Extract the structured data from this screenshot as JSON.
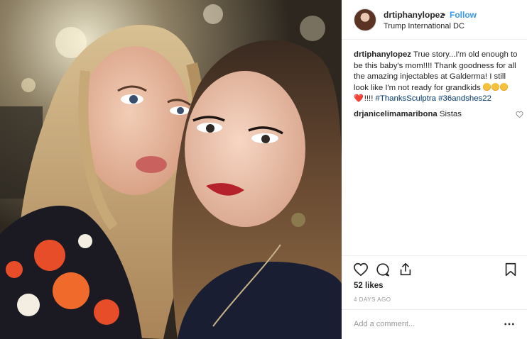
{
  "photo": {
    "alt_icon": "photo-of-two-women"
  },
  "header": {
    "username": "drtiphanylopez",
    "separator": "•",
    "follow_label": "Follow",
    "location": "Trump International DC",
    "avatar_icon": "profile-avatar"
  },
  "caption": {
    "username": "drtiphanylopez",
    "text_1": "True story...I'm old enough to be this baby's mom!!!! Thank goodness for all the amazing injectables at Galderma! I still look like I'm not ready for grandkids",
    "emoji_suffix": "!!!! ",
    "hashtag_1": "#ThanksSculptra",
    "hashtag_2": "#36andshes22"
  },
  "comment": {
    "username": "drjanicelimamaribona",
    "text": "Sistas"
  },
  "actions": {
    "like_icon": "heart-icon",
    "comment_icon": "comment-icon",
    "share_icon": "share-icon",
    "save_icon": "bookmark-icon"
  },
  "likes": "52 likes",
  "timestamp": "4 DAYS AGO",
  "add_comment": {
    "placeholder": "Add a comment...",
    "more_icon": "more-options-icon"
  },
  "colors": {
    "link_blue": "#3897f0",
    "hashtag_blue": "#003569",
    "border": "#efefef",
    "muted": "#999999"
  }
}
